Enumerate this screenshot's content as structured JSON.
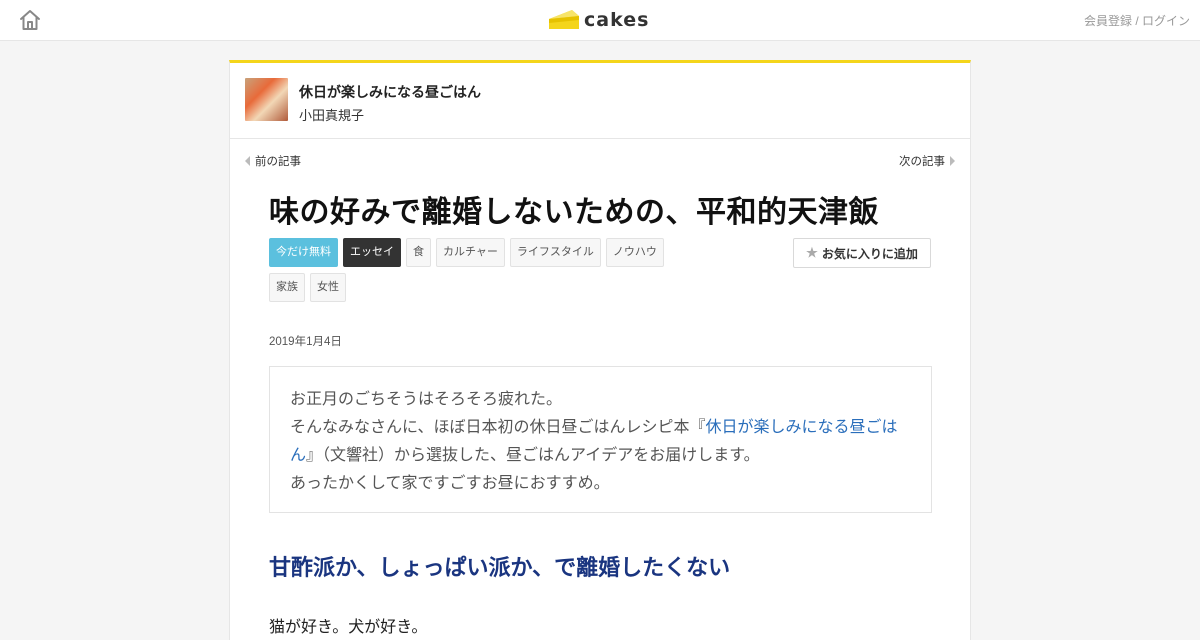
{
  "topbar": {
    "logo_text": "cakes",
    "login_label": "会員登録 / ログイン"
  },
  "series": {
    "title": "休日が楽しみになる昼ごはん",
    "author": "小田真規子"
  },
  "nav": {
    "prev_label": "前の記事",
    "next_label": "次の記事"
  },
  "article": {
    "title": "味の好みで離婚しないための、平和的天津飯",
    "date": "2019年1月4日",
    "tags": [
      {
        "label": "今だけ無料",
        "style": "free"
      },
      {
        "label": "エッセイ",
        "style": "dark"
      },
      {
        "label": "食",
        "style": "plain"
      },
      {
        "label": "カルチャー",
        "style": "plain"
      },
      {
        "label": "ライフスタイル",
        "style": "plain"
      },
      {
        "label": "ノウハウ",
        "style": "plain"
      },
      {
        "label": "家族",
        "style": "plain"
      },
      {
        "label": "女性",
        "style": "plain"
      }
    ],
    "fav_label": "お気に入りに追加",
    "intro": {
      "line1": "お正月のごちそうはそろそろ疲れた。",
      "line2_pre": "そんなみなさんに、ほぼ日本初の休日昼ごはんレシピ本『",
      "line2_link": "休日が楽しみになる昼ごはん",
      "line2_post": "』（文響社）から選抜した、昼ごはんアイデアをお届けします。",
      "line3": "あったかくして家ですごすお昼におすすめ。"
    },
    "section_heading": "甘酢派か、しょっぱい派か、で離婚したくない",
    "body_first_line": "猫が好き。犬が好き。"
  },
  "colors": {
    "accent_yellow": "#f4d51b",
    "link_blue": "#2a6ebb",
    "heading_navy": "#1a3580",
    "free_tag": "#5bc0de"
  }
}
